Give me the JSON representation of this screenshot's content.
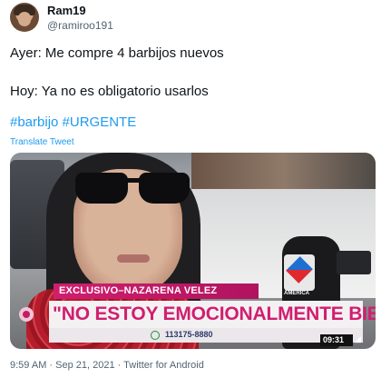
{
  "author": {
    "name": "Ram19",
    "handle": "@ramiroo191",
    "avatar_icon": "profile-photo"
  },
  "tweet": {
    "line1": "Ayer: Me compre 4 barbijos nuevos",
    "line2": "Hoy: Ya no es obligatorio usarlos",
    "hashtag1": "#barbijo",
    "hashtag2": "#URGENTE",
    "translate_label": "Translate Tweet"
  },
  "media": {
    "banner_top": "EXCLUSIVO–NAZARENA VELEZ",
    "banner_main": "\"NO ESTOY EMOCIONALMENTE BIEN\"",
    "phone": "113175-8880",
    "clock": "09:31",
    "mic_label": "AMERICA",
    "accent_color": "#d11e6f"
  },
  "meta": {
    "timestamp": "9:59 AM · Sep 21, 2021 · Twitter for Android"
  },
  "colors": {
    "link": "#1d9bf0",
    "text": "#0f1419",
    "muted": "#536471"
  }
}
